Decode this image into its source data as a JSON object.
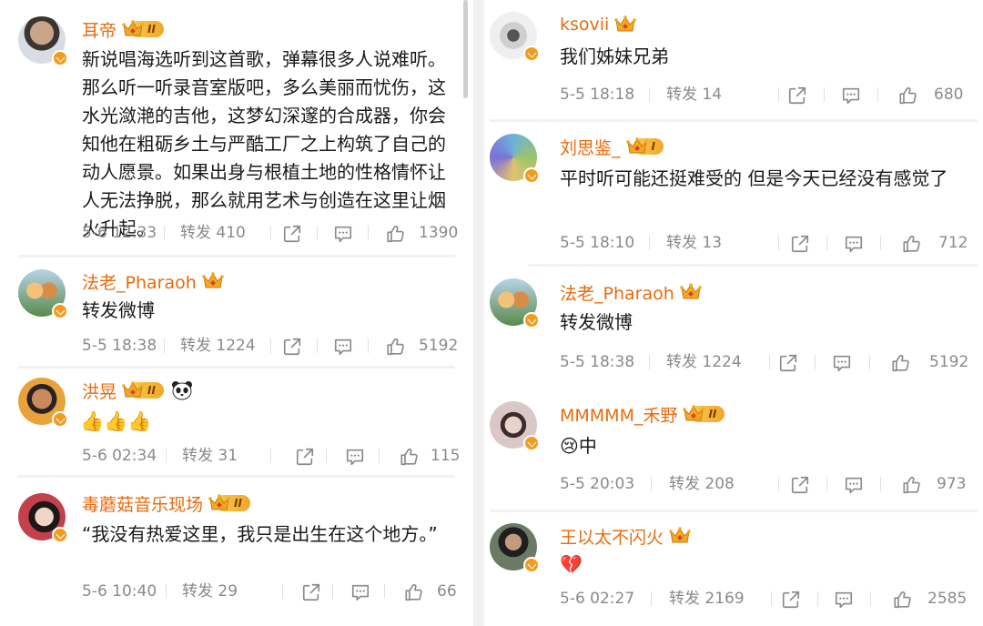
{
  "posts_left": [
    {
      "name": "耳帝",
      "level": "II",
      "content": "新说唱海选听到这首歌，弹幕很多人说难听。那么听一听录音室版吧，多么美丽而忧伤，这水光潋滟的吉他，这梦幻深邃的合成器，你会知他在粗砺乡土与严酷工厂之上构筑了自己的动人愿景。如果出身与根植土地的性格情怀让人无法挣脱，那么就用艺术与创造在这里让烟火升起。",
      "time": "5-6 12:33",
      "repost": "转发 410",
      "likes": "1390"
    },
    {
      "name": "法老_Pharaoh",
      "content": "转发微博",
      "time": "5-5 18:38",
      "repost": "转发 1224",
      "likes": "5192"
    },
    {
      "name": "洪晃",
      "level": "II",
      "content": "👍👍👍",
      "time": "5-6 02:34",
      "repost": "转发 31",
      "likes": "115"
    },
    {
      "name": "毒蘑菇音乐现场",
      "level": "II",
      "content": "“我没有热爱这里，我只是出生在这个地方。”",
      "time": "5-6 10:40",
      "repost": "转发 29",
      "likes": "66"
    }
  ],
  "posts_right": [
    {
      "name": "ksovii",
      "content": "我们姊妹兄弟",
      "time": "5-5 18:18",
      "repost": "转发 14",
      "likes": "680"
    },
    {
      "name": "刘思鉴_",
      "level": "I",
      "content": "平时听可能还挺难受的 但是今天已经没有感觉了",
      "time": "5-5 18:10",
      "repost": "转发 13",
      "likes": "712"
    },
    {
      "name": "法老_Pharaoh",
      "content": "转发微博",
      "time": "5-5 18:38",
      "repost": "转发 1224",
      "likes": "5192"
    },
    {
      "name": "MMMMM_禾野",
      "level": "II",
      "content": "😢中",
      "time": "5-5 20:03",
      "repost": "转发 208",
      "likes": "973"
    },
    {
      "name": "王以太不闪火",
      "content": "💔",
      "time": "5-6 02:27",
      "repost": "转发 2169",
      "likes": "2585"
    }
  ],
  "icons": {
    "share": "share-icon",
    "comment": "comment-icon",
    "like": "thumbs-up-icon",
    "crown": "crown-icon",
    "verified": "verified-badge-icon",
    "panda": "panda-icon"
  },
  "colors": {
    "name": "#e86b0c",
    "meta": "#8a8a8a",
    "badge": "#f39b1d"
  }
}
